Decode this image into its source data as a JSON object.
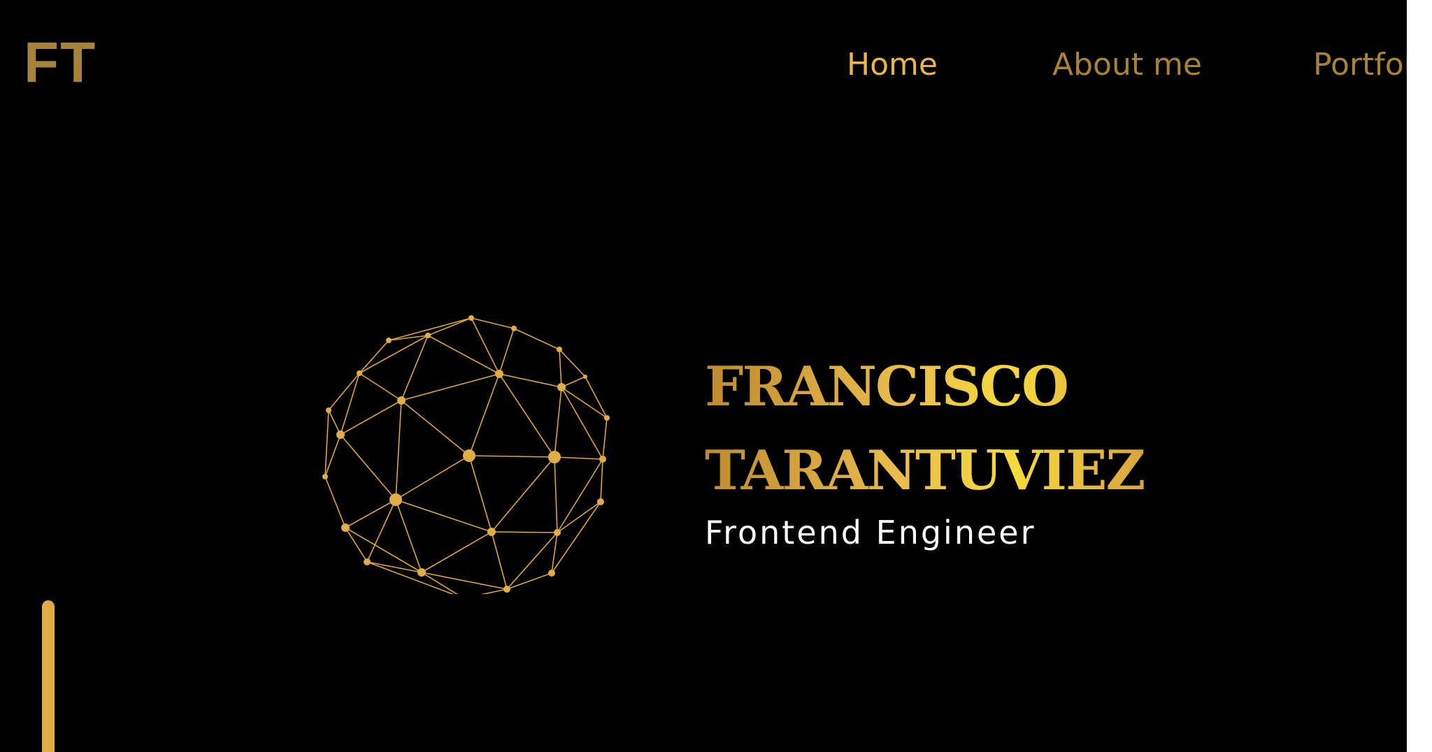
{
  "header": {
    "logo_text": "FT",
    "nav": [
      {
        "label": "Home",
        "active": true
      },
      {
        "label": "About me",
        "active": false
      },
      {
        "label": "Portfolio",
        "active": false
      }
    ]
  },
  "hero": {
    "name_line1": "FRANCISCO",
    "name_line2": "TARANTUVIEZ",
    "role": "Frontend Engineer",
    "graphic": "geodesic-sphere-network"
  },
  "colors": {
    "background": "#000000",
    "accent_gold": "#e3ab47",
    "muted_gold": "#a7823a",
    "text_white": "#ffffff"
  }
}
